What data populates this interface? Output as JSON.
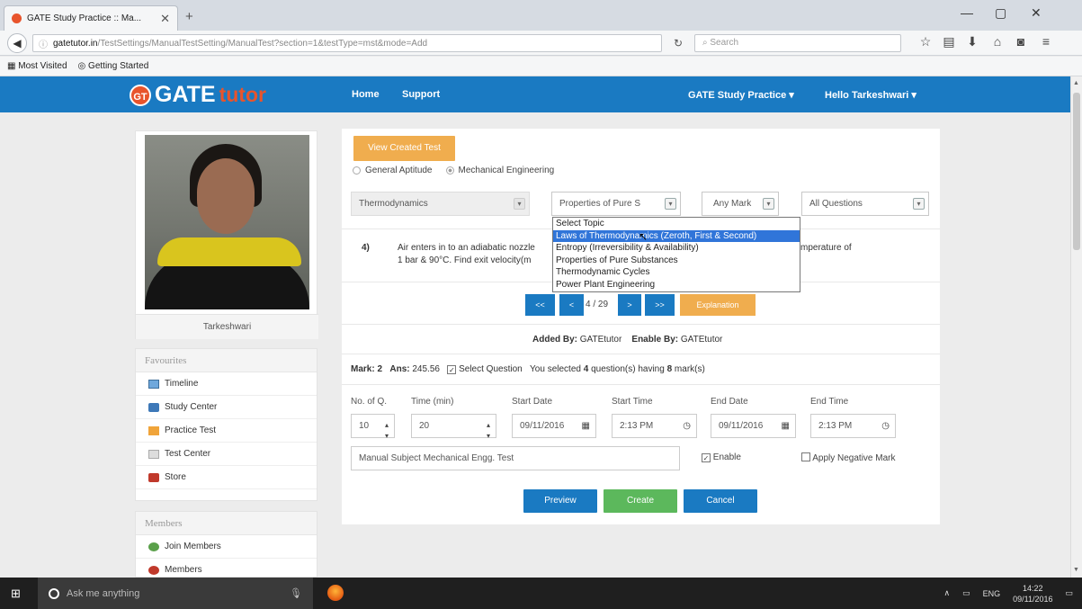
{
  "browser": {
    "tab_title": "GATE Study Practice :: Ma...",
    "url_host": "gatetutor.in",
    "url_path": "/TestSettings/ManualTestSetting/ManualTest?section=1&testType=mst&mode=Add",
    "search_placeholder": "Search",
    "bookmarks": [
      "Most Visited",
      "Getting Started"
    ]
  },
  "header": {
    "logo_badge": "GT",
    "logo_gate": "GATE",
    "logo_tutor": "tutor",
    "nav": {
      "home": "Home",
      "support": "Support",
      "study_practice": "GATE Study Practice",
      "user": "Hello Tarkeshwari"
    },
    "color": "#1a7ac2"
  },
  "profile": {
    "name": "Tarkeshwari"
  },
  "favourites": {
    "title": "Favourites",
    "items": [
      "Timeline",
      "Study Center",
      "Practice Test",
      "Test Center",
      "Store"
    ]
  },
  "members": {
    "title": "Members",
    "items": [
      "Join Members",
      "Members"
    ]
  },
  "main": {
    "view_created_btn": "View Created Test",
    "radio_general": "General Aptitude",
    "radio_mech": "Mechanical Engineering",
    "subject_select": "Thermodynamics",
    "topic_select": "Properties of Pure S",
    "mark_select": "Any Mark",
    "questions_select": "All Questions",
    "topic_options": [
      "Select Topic",
      "Laws of Thermodynamics (Zeroth, First & Second)",
      "Entropy (Irreversibility & Availability)",
      "Properties of Pure Substances",
      "Thermodynamic Cycles",
      "Power Plant Engineering"
    ],
    "question_no": "4)",
    "question_line1": "Air enters in to an adiabatic nozzle",
    "question_line1_end": "mperature of",
    "question_line2": "1 bar & 90°C. Find exit velocity(m",
    "pager": {
      "first": "<<",
      "prev": "<",
      "page": "4 / 29",
      "next": ">",
      "last": ">>",
      "explanation": "Explanation"
    },
    "added_by_label": "Added By:",
    "added_by": "GATEtutor",
    "enable_by_label": "Enable By:",
    "enable_by": "GATEtutor",
    "mark_label": "Mark: 2",
    "ans_label": "Ans:",
    "ans_value": "245.56",
    "select_question": "Select Question",
    "selected_text_pre": "You selected",
    "selected_count": "4",
    "selected_text_mid": "question(s) having",
    "selected_marks": "8",
    "selected_text_post": "mark(s)",
    "fields": {
      "no_q_label": "No. of Q.",
      "no_q": "10",
      "time_label": "Time (min)",
      "time": "20",
      "start_date_label": "Start Date",
      "start_date": "09/11/2016",
      "start_time_label": "Start Time",
      "start_time": "2:13 PM",
      "end_date_label": "End Date",
      "end_date": "09/11/2016",
      "end_time_label": "End Time",
      "end_time": "2:13 PM"
    },
    "test_name": "Manual Subject Mechanical Engg. Test",
    "enable_label": "Enable",
    "negative_label": "Apply Negative Mark",
    "preview_btn": "Preview",
    "create_btn": "Create",
    "cancel_btn": "Cancel"
  },
  "taskbar": {
    "search_placeholder": "Ask me anything",
    "lang": "ENG",
    "time": "14:22",
    "date": "09/11/2016"
  }
}
